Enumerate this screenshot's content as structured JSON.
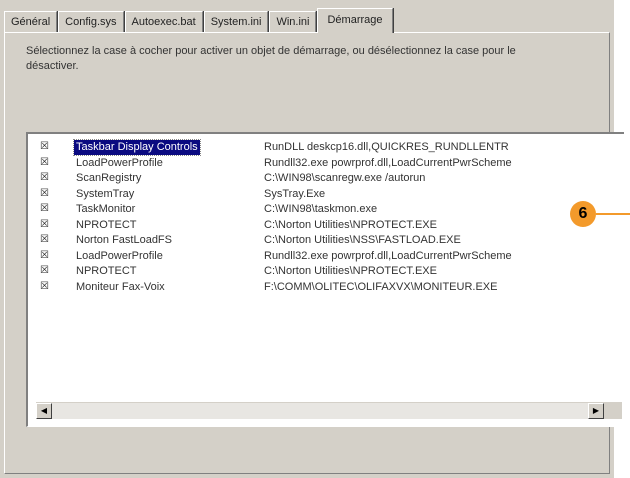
{
  "tabs": [
    {
      "label": "Général"
    },
    {
      "label": "Config.sys"
    },
    {
      "label": "Autoexec.bat"
    },
    {
      "label": "System.ini"
    },
    {
      "label": "Win.ini"
    },
    {
      "label": "Démarrage"
    }
  ],
  "active_tab": "Démarrage",
  "description": "Sélectionnez la case à cocher pour activer un objet de démarrage, ou désélectionnez la case pour le désactiver.",
  "startup_items": [
    {
      "checked": true,
      "name": "Taskbar Display Controls",
      "command": "RunDLL deskcp16.dll,QUICKRES_RUNDLLENTR",
      "selected": true
    },
    {
      "checked": true,
      "name": "LoadPowerProfile",
      "command": "Rundll32.exe powrprof.dll,LoadCurrentPwrScheme",
      "selected": false
    },
    {
      "checked": true,
      "name": "ScanRegistry",
      "command": "C:\\WIN98\\scanregw.exe /autorun",
      "selected": false
    },
    {
      "checked": true,
      "name": "SystemTray",
      "command": "SysTray.Exe",
      "selected": false
    },
    {
      "checked": true,
      "name": "TaskMonitor",
      "command": "C:\\WIN98\\taskmon.exe",
      "selected": false
    },
    {
      "checked": true,
      "name": "NPROTECT",
      "command": "C:\\Norton Utilities\\NPROTECT.EXE",
      "selected": false
    },
    {
      "checked": true,
      "name": "Norton FastLoadFS",
      "command": "C:\\Norton Utilities\\NSS\\FASTLOAD.EXE",
      "selected": false
    },
    {
      "checked": true,
      "name": "LoadPowerProfile",
      "command": "Rundll32.exe powrprof.dll,LoadCurrentPwrScheme",
      "selected": false
    },
    {
      "checked": true,
      "name": "NPROTECT",
      "command": "C:\\Norton Utilities\\NPROTECT.EXE",
      "selected": false
    },
    {
      "checked": true,
      "name": "Moniteur Fax-Voix",
      "command": "F:\\COMM\\OLITEC\\OLIFAXVX\\MONITEUR.EXE",
      "selected": false
    }
  ],
  "scrollbar": {
    "left_arrow_icon": "arrow-left-icon",
    "right_arrow_icon": "arrow-right-icon"
  },
  "callout": {
    "number": "6",
    "color": "#f39a2b"
  },
  "colors": {
    "dialog_bg": "#d4d0c8",
    "selection_bg": "#0a0a80"
  }
}
